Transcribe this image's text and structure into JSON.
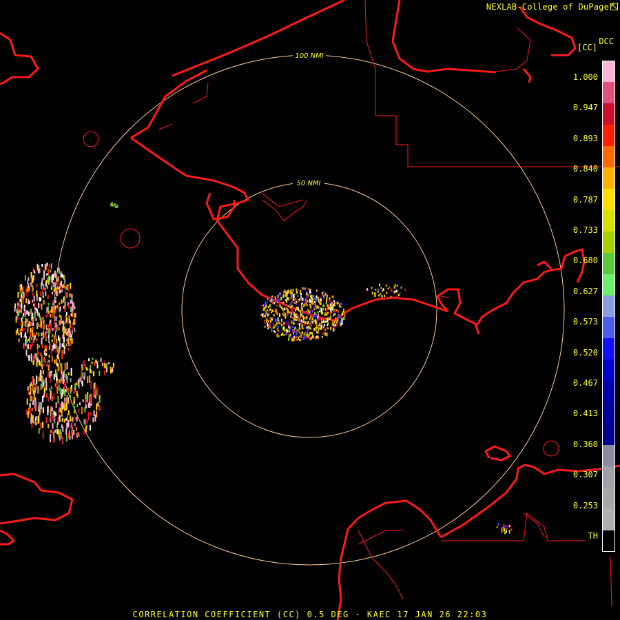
{
  "header": {
    "credit": "NEXLAB-College of DuPage",
    "product_code": "DCC",
    "units": "[CC]"
  },
  "rings": [
    {
      "label": "50 NMI"
    },
    {
      "label": "100 NMI"
    }
  ],
  "colorbar": {
    "labels": [
      "1.000",
      "0.947",
      "0.893",
      "0.840",
      "0.787",
      "0.733",
      "0.680",
      "0.627",
      "0.573",
      "0.520",
      "0.467",
      "0.413",
      "0.360",
      "0.307",
      "0.253",
      "TH"
    ],
    "colors": [
      "#ffb3d9",
      "#e05080",
      "#c8102e",
      "#ff2000",
      "#ff6a00",
      "#ffb000",
      "#ffe000",
      "#d8e000",
      "#a8d000",
      "#5cc83c",
      "#6cf06c",
      "#8c9ce0",
      "#4c5cf0",
      "#1010ff",
      "#0000d0",
      "#0000b0",
      "#00009c",
      "#000090",
      "#8c8ca0",
      "#a0a0a8",
      "#a8a8a8",
      "#b0b0b0",
      "#000000"
    ]
  },
  "footer": {
    "text": "CORRELATION COEFFICIENT (CC) 0.5 DEG - KAEC 17 JAN 26 22:03"
  },
  "colors": {
    "coast": "#ff1a1a",
    "ring": "#ffcc99",
    "text": "#ffff33",
    "background": "#000000"
  }
}
